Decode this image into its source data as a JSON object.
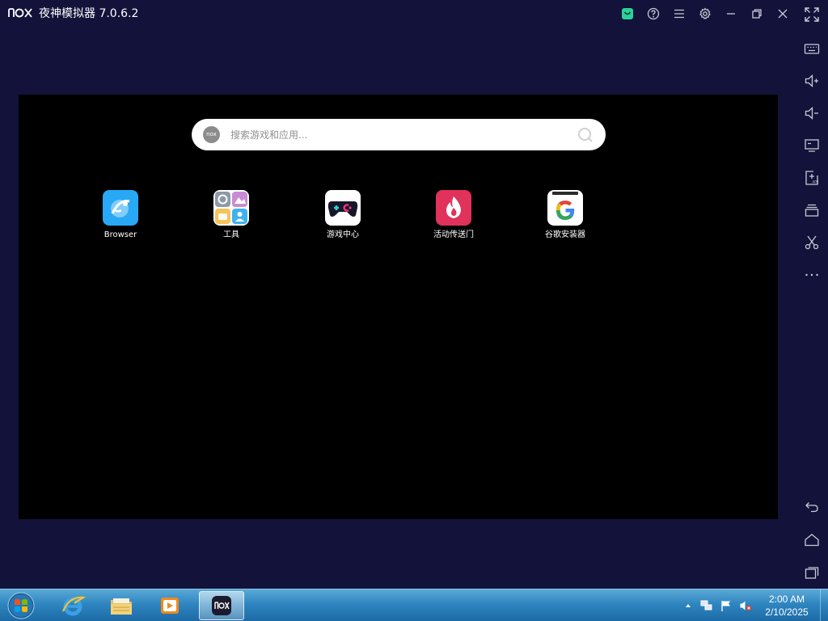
{
  "window": {
    "title": "夜神模拟器 7.0.6.2",
    "logo_text": "nox",
    "controls": [
      "shop-icon",
      "help-icon",
      "menu-icon",
      "settings-icon",
      "minimize-icon",
      "restore-icon",
      "close-icon",
      "fullscreen-icon"
    ]
  },
  "sidebar": {
    "items": [
      "keyboard-icon",
      "volume-up-icon",
      "volume-down-icon",
      "screen-icon",
      "add-apk-icon",
      "multi-instance-icon",
      "screenshot-icon",
      "more-icon"
    ],
    "nav": [
      "back-icon",
      "home-icon",
      "recents-icon"
    ],
    "apk_label": "APK"
  },
  "search": {
    "placeholder": "搜索游戏和应用...",
    "logo_text": "nox"
  },
  "apps": [
    {
      "label": "Browser",
      "icon": "browser-icon"
    },
    {
      "label": "工具",
      "icon": "tools-icon"
    },
    {
      "label": "游戏中心",
      "icon": "game-center-icon"
    },
    {
      "label": "活动传送门",
      "icon": "event-portal-icon"
    },
    {
      "label": "谷歌安装器",
      "icon": "google-installer-icon"
    }
  ],
  "taskbar": {
    "pinned": [
      "start-icon",
      "internet-explorer-icon",
      "file-explorer-icon",
      "media-player-icon",
      "nox-icon"
    ],
    "clock_time": "2:00 AM",
    "clock_date": "2/10/2025"
  },
  "colors": {
    "frame": "#12123a",
    "screen": "#000000",
    "shop_accent": "#2bd19a",
    "browser": "#29a8f5",
    "event": "#e0325a",
    "taskbar": "#2f86c0"
  }
}
